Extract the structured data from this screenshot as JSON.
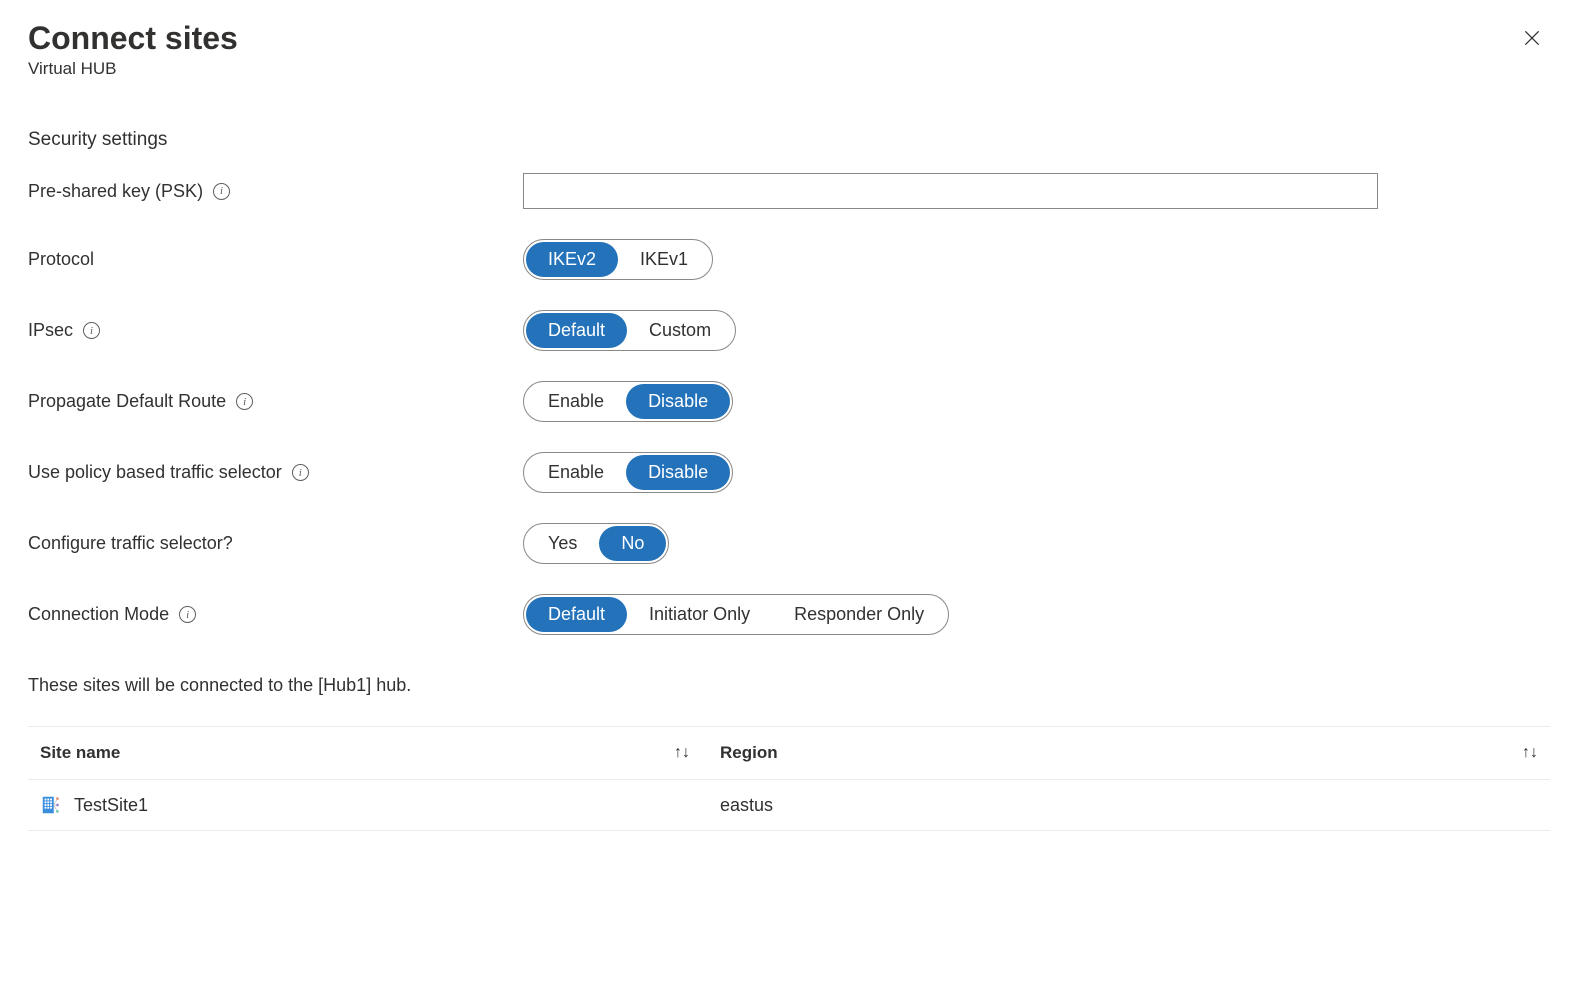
{
  "header": {
    "title": "Connect sites",
    "subtitle": "Virtual HUB"
  },
  "section_title": "Security settings",
  "fields": {
    "psk": {
      "label": "Pre-shared key (PSK)",
      "value": ""
    },
    "protocol": {
      "label": "Protocol",
      "options": [
        "IKEv2",
        "IKEv1"
      ],
      "selected": "IKEv2"
    },
    "ipsec": {
      "label": "IPsec",
      "options": [
        "Default",
        "Custom"
      ],
      "selected": "Default"
    },
    "propagate_default_route": {
      "label": "Propagate Default Route",
      "options": [
        "Enable",
        "Disable"
      ],
      "selected": "Disable"
    },
    "use_policy_based": {
      "label": "Use policy based traffic selector",
      "options": [
        "Enable",
        "Disable"
      ],
      "selected": "Disable"
    },
    "configure_traffic_selector": {
      "label": "Configure traffic selector?",
      "options": [
        "Yes",
        "No"
      ],
      "selected": "No"
    },
    "connection_mode": {
      "label": "Connection Mode",
      "options": [
        "Default",
        "Initiator Only",
        "Responder Only"
      ],
      "selected": "Default"
    }
  },
  "hub_info": "These sites will be connected to the [Hub1] hub.",
  "table": {
    "columns": {
      "site_name": "Site name",
      "region": "Region"
    },
    "rows": [
      {
        "site_name": "TestSite1",
        "region": "eastus"
      }
    ]
  }
}
